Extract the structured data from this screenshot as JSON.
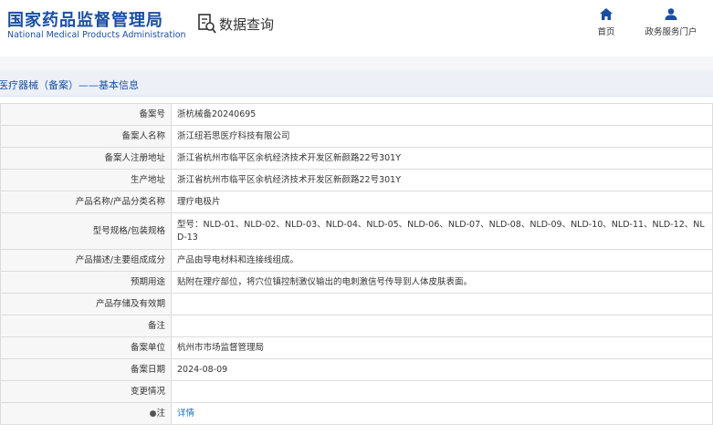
{
  "header": {
    "logo_cn": "国家药品监督管理局",
    "logo_en": "National Medical Products Administration",
    "query_label": "数据查询",
    "nav": {
      "home": "首页",
      "portal": "政务服务门户"
    }
  },
  "section_title": "医疗器械（备案）——基本信息",
  "rows": [
    {
      "label": "备案号",
      "value": "浙杭械备20240695"
    },
    {
      "label": "备案人名称",
      "value": "浙江纽若思医疗科技有限公司"
    },
    {
      "label": "备案人注册地址",
      "value": "浙江省杭州市临平区余杭经济技术开发区新颜路22号301Y"
    },
    {
      "label": "生产地址",
      "value": "浙江省杭州市临平区余杭经济技术开发区新颜路22号301Y"
    },
    {
      "label": "产品名称/产品分类名称",
      "value": "理疗电极片"
    },
    {
      "label": "型号规格/包装规格",
      "value": "型号：NLD-01、NLD-02、NLD-03、NLD-04、NLD-05、NLD-06、NLD-07、NLD-08、NLD-09、NLD-10、NLD-11、NLD-12、NLD-13"
    },
    {
      "label": "产品描述/主要组成成分",
      "value": "产品由导电材料和连接线组成。"
    },
    {
      "label": "预期用途",
      "value": "贴附在理疗部位，将穴位镇控制激仪输出的电刺激信号传导到人体皮肤表面。"
    },
    {
      "label": "产品存储及有效期",
      "value": ""
    },
    {
      "label": "备注",
      "value": ""
    },
    {
      "label": "备案单位",
      "value": "杭州市市场监督管理局"
    },
    {
      "label": "备案日期",
      "value": "2024-08-09"
    },
    {
      "label": "变更情况",
      "value": ""
    },
    {
      "label": "注",
      "value": "详情"
    }
  ],
  "colors": {
    "brand_blue": "#1a4ea3",
    "link_blue": "#1a6fc7",
    "label_bg": "#f7f7f7",
    "bar_bg": "#edf1f7"
  },
  "icons": {
    "query": "search-document-icon",
    "home": "home-icon",
    "portal": "user-icon",
    "note": "pin-icon"
  }
}
